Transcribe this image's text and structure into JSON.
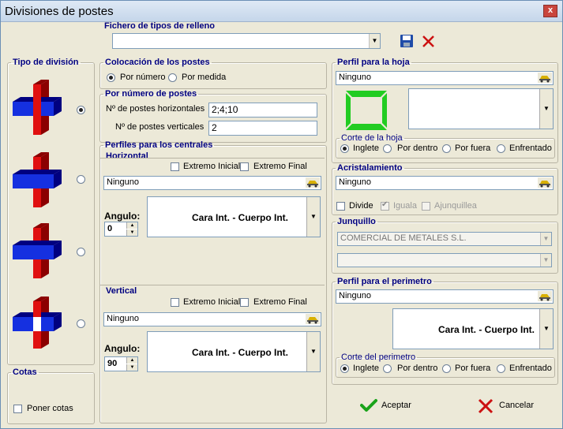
{
  "window": {
    "title": "Divisiones de postes",
    "close_label": "x"
  },
  "fichero": {
    "legend": "Fichero de tipos de relleno",
    "value": ""
  },
  "tipo_division": {
    "legend": "Tipo de división",
    "options": [
      {
        "name": "cross-full-vertical",
        "selected": true
      },
      {
        "name": "cross-full-horizontal",
        "selected": false
      },
      {
        "name": "cross-both-through",
        "selected": false
      },
      {
        "name": "cross-interlocked",
        "selected": false
      }
    ]
  },
  "cotas": {
    "legend": "Cotas",
    "poner_cotas_label": "Poner cotas",
    "poner_cotas_checked": false
  },
  "colocacion": {
    "legend": "Colocación de los postes",
    "por_numero_label": "Por número",
    "por_medida_label": "Por medida",
    "selected": "por_numero"
  },
  "por_numero": {
    "legend": "Por número de postes",
    "horizontales_label": "Nº de postes horizontales",
    "horizontales_value": "2;4;10",
    "verticales_label": "Nº de postes verticales",
    "verticales_value": "2"
  },
  "perfiles_centrales": {
    "legend": "Perfiles para los centrales",
    "horizontal": {
      "title": "Horizontal",
      "extremo_inicial": "Extremo Inicial",
      "extremo_final": "Extremo Final",
      "perfil": "Ninguno",
      "angulo_label": "Angulo:",
      "angulo_value": "0",
      "cara_text": "Cara Int. - Cuerpo Int."
    },
    "vertical": {
      "title": "Vertical",
      "extremo_inicial": "Extremo Inicial",
      "extremo_final": "Extremo Final",
      "perfil": "Ninguno",
      "angulo_label": "Angulo:",
      "angulo_value": "90",
      "cara_text": "Cara Int. - Cuerpo Int."
    }
  },
  "perfil_hoja": {
    "legend": "Perfil para la hoja",
    "value": "Ninguno",
    "corte_legend": "Corte de la hoja",
    "cortes": [
      "Inglete",
      "Por dentro",
      "Por fuera",
      "Enfrentado"
    ],
    "selected": 0
  },
  "acristalamiento": {
    "legend": "Acristalamiento",
    "value": "Ninguno",
    "divide_label": "Divide",
    "iguala_label": "Iguala",
    "ajunquillea_label": "Ajunquillea"
  },
  "junquillo": {
    "legend": "Junquillo",
    "value1": "COMERCIAL DE METALES S.L.",
    "value2": ""
  },
  "perfil_perimetro": {
    "legend": "Perfil para el perimetro",
    "value": "Ninguno",
    "cara_text": "Cara Int. - Cuerpo Int.",
    "corte_legend": "Corte del perimetro",
    "cortes": [
      "Inglete",
      "Por dentro",
      "Por fuera",
      "Enfrentado"
    ],
    "selected": 0
  },
  "buttons": {
    "aceptar": "Aceptar",
    "cancelar": "Cancelar"
  },
  "colors": {
    "accent_legend": "#000080",
    "green_icon": "#22cc22",
    "red": "#cc1111",
    "blue": "#1530e0"
  }
}
